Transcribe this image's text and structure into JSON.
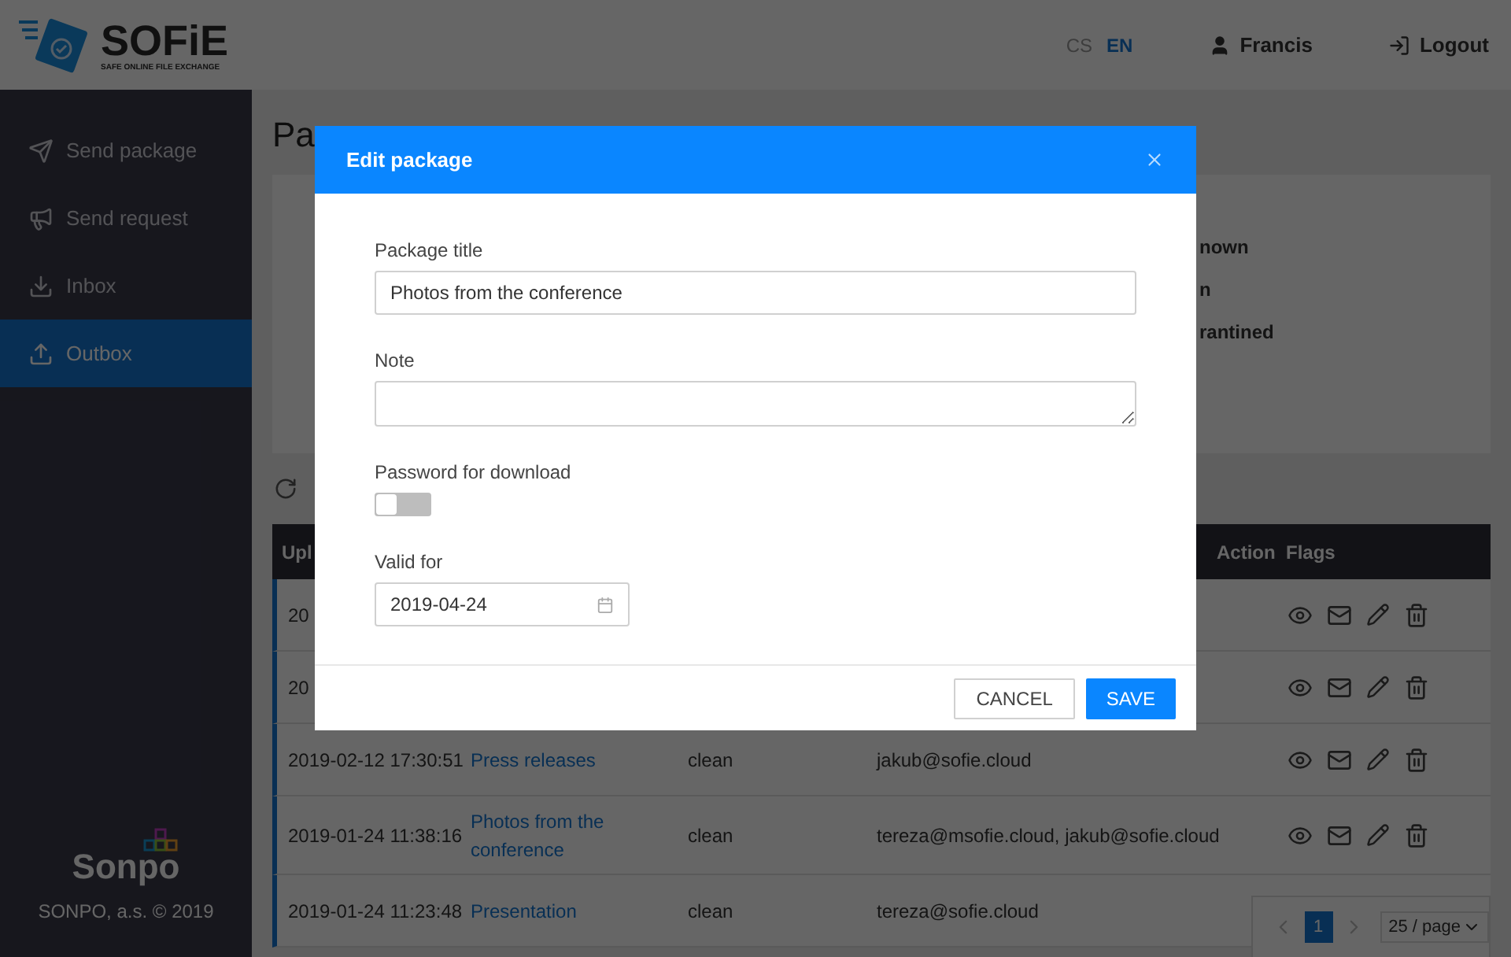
{
  "header": {
    "logo": {
      "title": "SOFiE",
      "subtitle": "SAFE ONLINE FILE EXCHANGE"
    },
    "languages": [
      {
        "label": "CS",
        "selected": false
      },
      {
        "label": "EN",
        "selected": true
      }
    ],
    "user": "Francis",
    "logout": "Logout"
  },
  "sidebar": {
    "items": [
      {
        "label": "Send package",
        "selected": false
      },
      {
        "label": "Send request",
        "selected": false
      },
      {
        "label": "Inbox",
        "selected": false
      },
      {
        "label": "Outbox",
        "selected": true
      }
    ],
    "brand": "Sonpo",
    "copyright": "SONPO, a.s. © 2019"
  },
  "page": {
    "title": "Pa",
    "filter_texts": [
      "nown",
      "n",
      "rantined"
    ],
    "table": {
      "columns": [
        "Upl",
        "Action",
        "Flags"
      ],
      "rows": [
        {
          "date": "20",
          "flag_icons": true
        },
        {
          "date": "20",
          "flag_icons": true
        },
        {
          "date": "2019-02-12 17:30:51",
          "name": "Press releases",
          "status": "clean",
          "recipients": "jakub@sofie.cloud",
          "flag_icons": true
        },
        {
          "date": "2019-01-24 11:38:16",
          "name": "Photos from the conference",
          "status": "clean",
          "recipients": "tereza@msofie.cloud, jakub@sofie.cloud",
          "flag_icons": true
        },
        {
          "date": "2019-01-24 11:23:48",
          "name": "Presentation",
          "status": "clean",
          "recipients": "tereza@sofie.cloud"
        }
      ]
    },
    "pagination": {
      "pages": [
        {
          "label": "1",
          "selected": true
        }
      ],
      "page_size": "25 / page"
    }
  },
  "modal": {
    "title": "Edit package",
    "fields": [
      {
        "kind": "text",
        "label": "Package title",
        "value": "Photos from the conference"
      },
      {
        "kind": "textarea",
        "label": "Note"
      },
      {
        "kind": "switch",
        "label": "Password for download",
        "on": false
      },
      {
        "kind": "date",
        "label": "Valid for",
        "value": "2019-04-24"
      }
    ],
    "buttons": [
      {
        "label": "CANCEL",
        "kind": "secondary"
      },
      {
        "label": "SAVE",
        "kind": "primary"
      }
    ]
  }
}
